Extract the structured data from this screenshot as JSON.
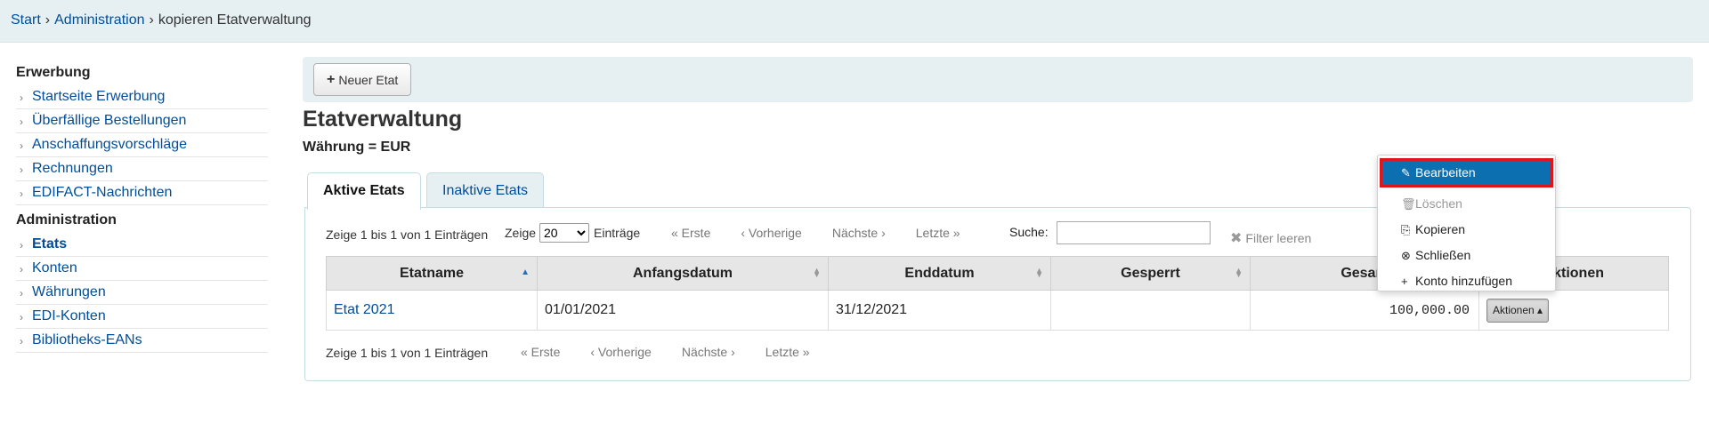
{
  "breadcrumb": {
    "items": [
      "Start",
      "Administration"
    ],
    "current": "kopieren Etatverwaltung",
    "separator": "›"
  },
  "sidebar": {
    "sections": [
      {
        "heading": "Erwerbung",
        "items": [
          "Startseite Erwerbung",
          "Überfällige Bestellungen",
          "Anschaffungsvorschläge",
          "Rechnungen",
          "EDIFACT-Nachrichten"
        ]
      },
      {
        "heading": "Administration",
        "items": [
          "Etats",
          "Konten",
          "Währungen",
          "EDI-Konten",
          "Bibliotheks-EANs"
        ],
        "active": "Etats"
      }
    ]
  },
  "toolbar": {
    "new_label": "Neuer Etat"
  },
  "page": {
    "title": "Etatverwaltung",
    "currency": "Währung = EUR"
  },
  "tabs": [
    {
      "label": "Aktive Etats",
      "active": true
    },
    {
      "label": "Inaktive Etats",
      "active": false
    }
  ],
  "table_controls": {
    "info": "Zeige 1 bis 1 von 1 Einträgen",
    "length_prefix": "Zeige",
    "length_value": "20",
    "length_suffix": "Einträge",
    "pager": {
      "first": "« Erste",
      "prev": "‹ Vorherige",
      "next": "Nächste ›",
      "last": "Letzte »"
    },
    "search_label": "Suche:",
    "filter_clear": "Filter leeren"
  },
  "table": {
    "headers": [
      "Etatname",
      "Anfangsdatum",
      "Enddatum",
      "Gesperrt",
      "Gesam",
      "ktionen"
    ],
    "rows": [
      {
        "name": "Etat 2021",
        "start": "01/01/2021",
        "end": "31/12/2021",
        "locked": "",
        "total": "100,000.00",
        "action": "Aktionen ▴"
      }
    ]
  },
  "dropdown": {
    "items": [
      {
        "label": "Bearbeiten",
        "icon": "pencil-icon",
        "glyph": "✎"
      },
      {
        "label": "Löschen",
        "icon": "trash-icon",
        "glyph": "🗑"
      },
      {
        "label": "Kopieren",
        "icon": "copy-icon",
        "glyph": "⎘"
      },
      {
        "label": "Schließen",
        "icon": "close-circle-icon",
        "glyph": "⊗"
      },
      {
        "label": "Konto hinzufügen",
        "icon": "plus-icon",
        "glyph": "+"
      }
    ]
  },
  "colors": {
    "link": "#004d99",
    "highlight": "#0c6fb0",
    "highlight_border": "#e0141d",
    "bar": "#e6f0f2"
  }
}
